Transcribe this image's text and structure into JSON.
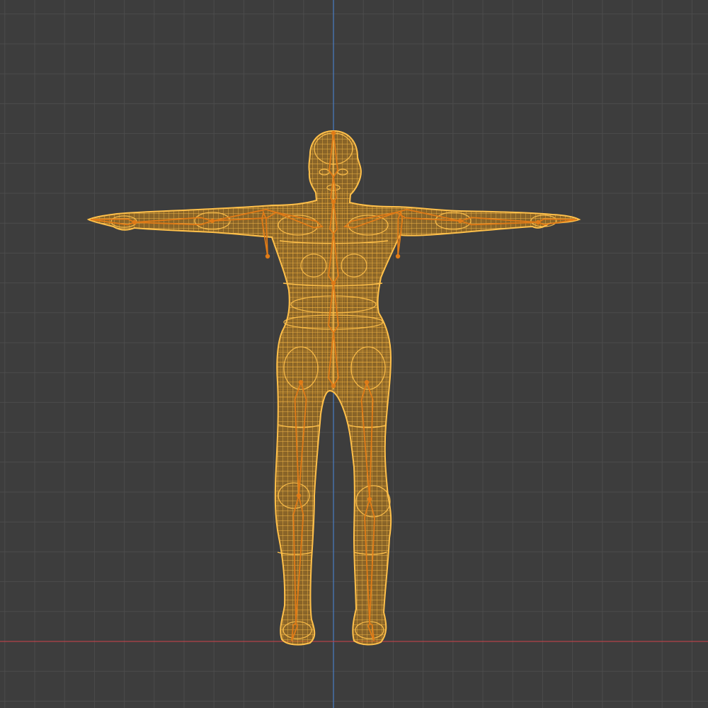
{
  "viewport": {
    "background": "#3d3d3d",
    "grid_color": "#4c4c4c",
    "axis_x_color": "#b3434a",
    "axis_z_color": "#4a7dc4",
    "grid": true
  },
  "object": {
    "type": "human-mesh-wireframe",
    "pose": "T-pose",
    "selected": true,
    "wire_color": "#f5a623",
    "wire_highlight_color": "#ffc04a",
    "fill_color": "#c98518",
    "bone_color": "#e07b17"
  }
}
